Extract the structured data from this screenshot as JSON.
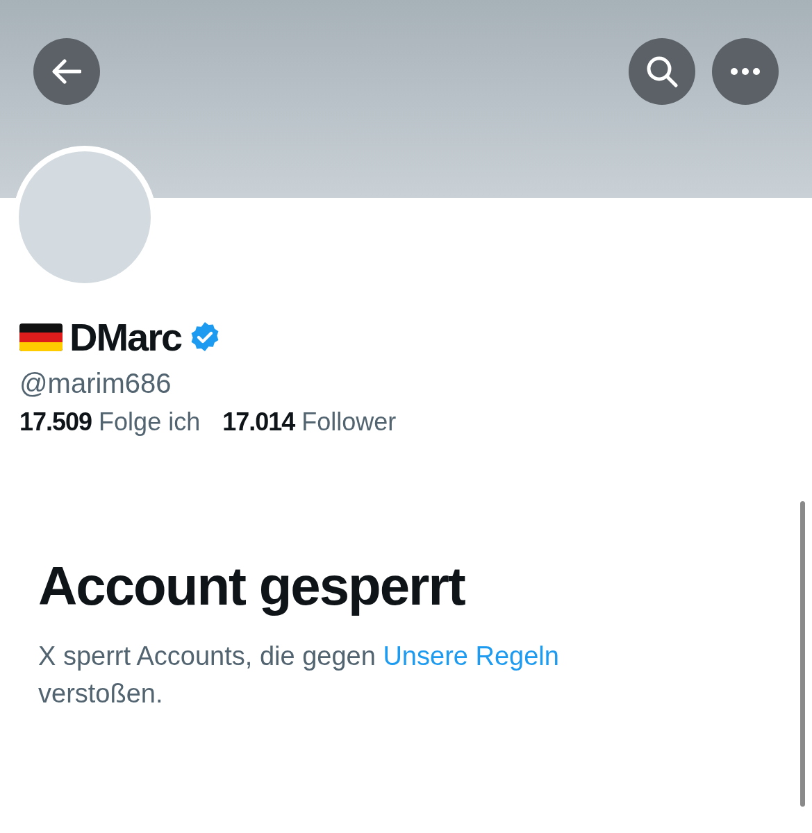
{
  "header": {
    "buttons": [
      {
        "kind": "back"
      },
      {
        "kind": "search"
      },
      {
        "kind": "more"
      }
    ]
  },
  "profile": {
    "name": "DMarc",
    "verified": true,
    "handle": "@marim686",
    "stats": [
      {
        "text": "**17.509** Folge ich"
      },
      {
        "text": "**17.014** Follower"
      }
    ]
  },
  "notice": {
    "title": "Account gesperrt",
    "text_before": "X sperrt Accounts, die gegen ",
    "link": "Unsere Regeln",
    "text_after": " verstoßen."
  }
}
